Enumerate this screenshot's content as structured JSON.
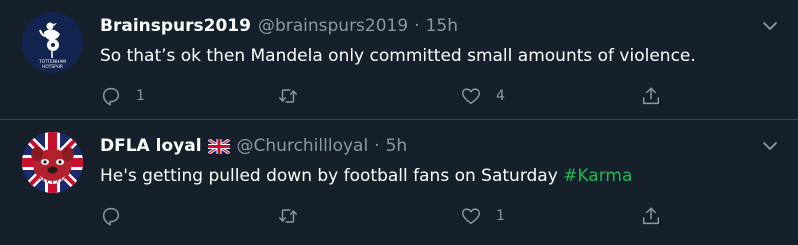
{
  "colors": {
    "background": "#15202b",
    "divider": "#38444d",
    "secondary_text": "#8899a6",
    "primary_text": "#ffffff",
    "hashtag": "#1db954"
  },
  "tweets": [
    {
      "display_name": "Brainspurs2019",
      "handle": "@brainspurs2019",
      "separator": "·",
      "time": "15h",
      "text": "So that’s ok then Mandela only committed small amounts of violence.",
      "hashtag": "",
      "avatar_icon": "tottenham-hotspur-crest",
      "avatar_text_1": "TOTTENHAM",
      "avatar_text_2": "HOTSPUR",
      "actions": {
        "reply_count": "1",
        "retweet_count": "",
        "like_count": "4"
      }
    },
    {
      "display_name": "DFLA loyal",
      "name_flag": "union-jack-flag",
      "handle": "@Churchillloyal",
      "separator": "·",
      "time": "5h",
      "text": "He's getting pulled down by football fans on Saturday ",
      "hashtag": "#Karma",
      "avatar_icon": "bulldog-union-jack",
      "actions": {
        "reply_count": "",
        "retweet_count": "",
        "like_count": "1"
      }
    }
  ]
}
